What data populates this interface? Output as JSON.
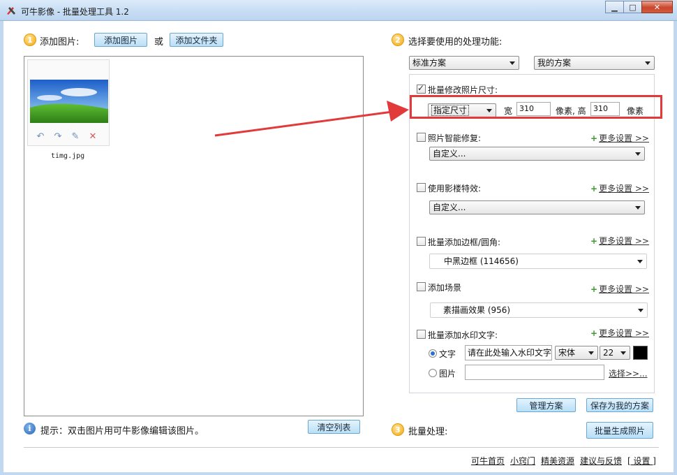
{
  "window": {
    "title": "可牛影像 - 批量处理工具 1.2",
    "minimize": "▁",
    "maximize": "□",
    "close": "✕"
  },
  "left": {
    "step_num": "1",
    "add_label": "添加图片:",
    "add_image_button": "添加图片",
    "or_text": "或",
    "add_folder_button": "添加文件夹",
    "images": [
      {
        "name": "timg.jpg",
        "tools": [
          "rotate-left-icon",
          "rotate-right-icon",
          "edit-icon",
          "delete-icon"
        ]
      }
    ],
    "hint": "提示：双击图片用可牛影像编辑该图片。",
    "clear_button": "清空列表"
  },
  "right": {
    "step2_num": "2",
    "step2_label": "选择要使用的处理功能:",
    "preset_standard": "标准方案",
    "preset_mine": "我的方案",
    "resize": {
      "label": "批量修改照片尺寸:",
      "checked": true,
      "mode": "指定尺寸",
      "width_label": "宽",
      "width": "310",
      "height_label": "像素, 高",
      "height": "310",
      "unit": "像素"
    },
    "repair": {
      "label": "照片智能修复:",
      "checked": false,
      "more": "更多设置 >>",
      "value": "自定义..."
    },
    "effect": {
      "label": "使用影楼特效:",
      "checked": false,
      "more": "更多设置 >>",
      "value": "自定义..."
    },
    "border": {
      "label": "批量添加边框/圆角:",
      "checked": false,
      "more": "更多设置 >>",
      "value": "中黑边框 (114656)"
    },
    "scene": {
      "label": "添加场景",
      "checked": false,
      "more": "更多设置 >>",
      "value": "素描画效果 (956)"
    },
    "watermark": {
      "label": "批量添加水印文字:",
      "checked": false,
      "more": "更多设置 >>",
      "text_option": "文字",
      "text_placeholder": "请在此处输入水印文字",
      "font": "宋体",
      "size": "22",
      "color": "#000000",
      "image_option": "图片",
      "browse": "选择>>..."
    },
    "manage_button": "管理方案",
    "save_button": "保存为我的方案",
    "step3_num": "3",
    "step3_label": "批量处理:",
    "generate_button": "批量生成照片"
  },
  "footer": {
    "links": [
      "可牛首页",
      "小窍门",
      "精美资源",
      "建议与反馈",
      "[ 设置 ]"
    ]
  }
}
